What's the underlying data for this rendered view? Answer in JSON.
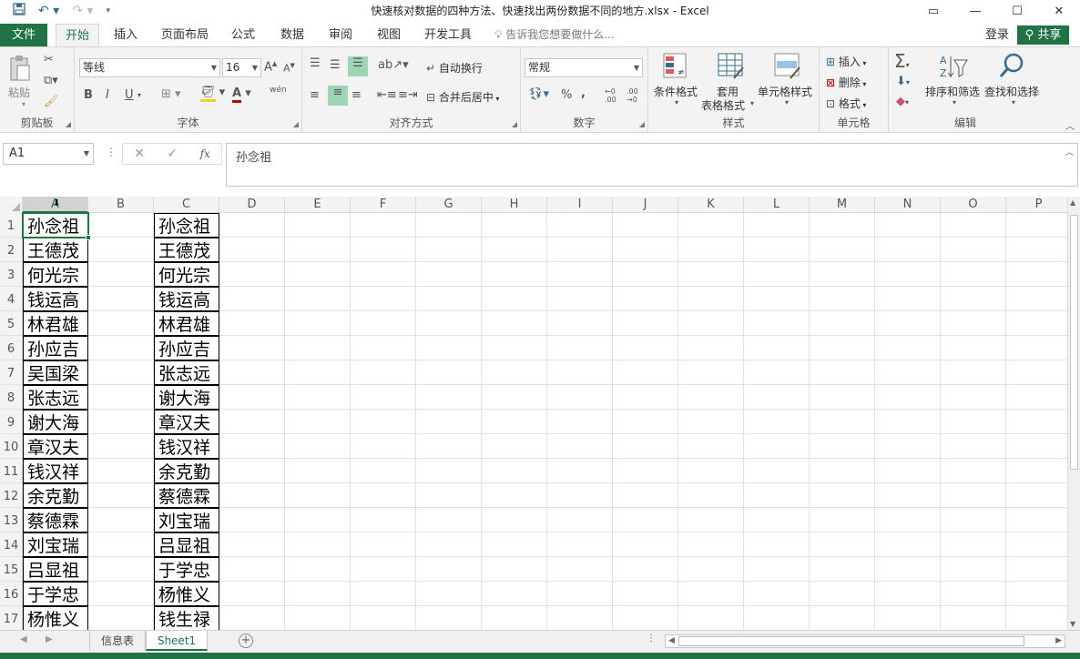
{
  "window": {
    "title": "快速核对数据的四种方法、快速找出两份数据不同的地方.xlsx - Excel",
    "qat": {
      "save_icon": "save-icon",
      "undo_icon": "undo-icon",
      "redo_icon": "redo-icon",
      "customize_icon": "customize-qat-icon"
    },
    "controls": {
      "restore_ribbon": "ribbon-display-icon",
      "minimize": "minimize-icon",
      "maximize": "maximize-icon",
      "close": "close-icon"
    }
  },
  "tabs": {
    "file": "文件",
    "home": "开始",
    "insert": "插入",
    "page_layout": "页面布局",
    "formulas": "公式",
    "data": "数据",
    "review": "审阅",
    "view": "视图",
    "developer": "开发工具",
    "tell_me": "告诉我您想要做什么...",
    "login": "登录",
    "share": "共享"
  },
  "ribbon": {
    "clipboard": {
      "label": "剪贴板",
      "paste": "粘贴"
    },
    "font": {
      "label": "字体",
      "name": "等线",
      "size": "16",
      "bold": "B",
      "italic": "I",
      "underline": "U",
      "phonetic": "wén"
    },
    "alignment": {
      "label": "对齐方式",
      "wrap": "自动换行",
      "merge": "合并后居中"
    },
    "number": {
      "label": "数字",
      "format": "常规",
      "percent": "%",
      "comma": ",",
      "inc": "←0 .00",
      "dec": ".00 →0"
    },
    "styles": {
      "label": "样式",
      "conditional": "条件格式",
      "table_line1": "套用",
      "table_line2": "表格格式",
      "cell_styles": "单元格样式"
    },
    "cells": {
      "label": "单元格",
      "insert": "插入",
      "delete": "删除",
      "format": "格式"
    },
    "editing": {
      "label": "编辑",
      "sort": "排序和筛选",
      "find": "查找和选择"
    }
  },
  "formula_bar": {
    "name_box": "A1",
    "cancel": "✕",
    "enter": "✓",
    "fx": "fx",
    "content": "孙念祖"
  },
  "sheet": {
    "columns": [
      "A",
      "B",
      "C",
      "D",
      "E",
      "F",
      "G",
      "H",
      "I",
      "J",
      "K",
      "L",
      "M",
      "N",
      "O",
      "P"
    ],
    "rows": [
      "1",
      "2",
      "3",
      "4",
      "5",
      "6",
      "7",
      "8",
      "9",
      "10",
      "11",
      "12",
      "13",
      "14",
      "15",
      "16",
      "17"
    ],
    "col_a": [
      "孙念祖",
      "王德茂",
      "何光宗",
      "钱运高",
      "林君雄",
      "孙应吉",
      "吴国梁",
      "张志远",
      "谢大海",
      "章汉夫",
      "钱汉祥",
      "余克勤",
      "蔡德霖",
      "刘宝瑞",
      "吕显祖",
      "于学忠",
      "杨惟义"
    ],
    "col_c": [
      "孙念祖",
      "王德茂",
      "何光宗",
      "钱运高",
      "林君雄",
      "孙应吉",
      "张志远",
      "谢大海",
      "章汉夫",
      "钱汉祥",
      "余克勤",
      "蔡德霖",
      "刘宝瑞",
      "吕显祖",
      "于学忠",
      "杨惟义",
      "钱生禄"
    ],
    "selected_cell": "A1"
  },
  "sheet_tabs": {
    "tabs": [
      "信息表",
      "Sheet1"
    ],
    "active": "Sheet1",
    "add": "+"
  },
  "colors": {
    "accent": "#217346",
    "highlight": "#9fd5b7"
  }
}
